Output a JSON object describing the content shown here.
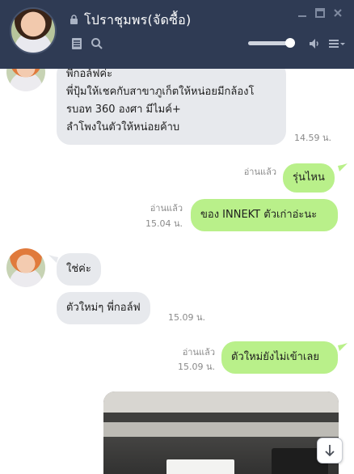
{
  "header": {
    "title": "โปราชุมพร(จัดซื้อ)",
    "volume_level": 0.9
  },
  "messages": [
    {
      "text_lines": [
        "พี่กอล์ฟค่ะ",
        "พี่ปุ้มให้เชคกับสาขาภูเก็ตให้หน่อยมีกล้องโ",
        "รบอท 360 องศา มีไมค์+",
        "ลำโพงในตัวให้หน่อยค้าบ"
      ],
      "time": "14.59 น."
    },
    {
      "text": "รุ่นไหน",
      "read": "อ่านแล้ว"
    },
    {
      "text": "ของ INNEKT ตัวเก่าอ่ะนะ",
      "read": "อ่านแล้ว",
      "time": "15.04 น."
    },
    {
      "text": "ใช่ค่ะ"
    },
    {
      "text": "ตัวใหม่ๆ พี่กอล์ฟ",
      "time": "15.09 น."
    },
    {
      "text": "ตัวใหม่ยังไม่เข้าเลย",
      "read": "อ่านแล้ว",
      "time": "15.09 น."
    }
  ]
}
